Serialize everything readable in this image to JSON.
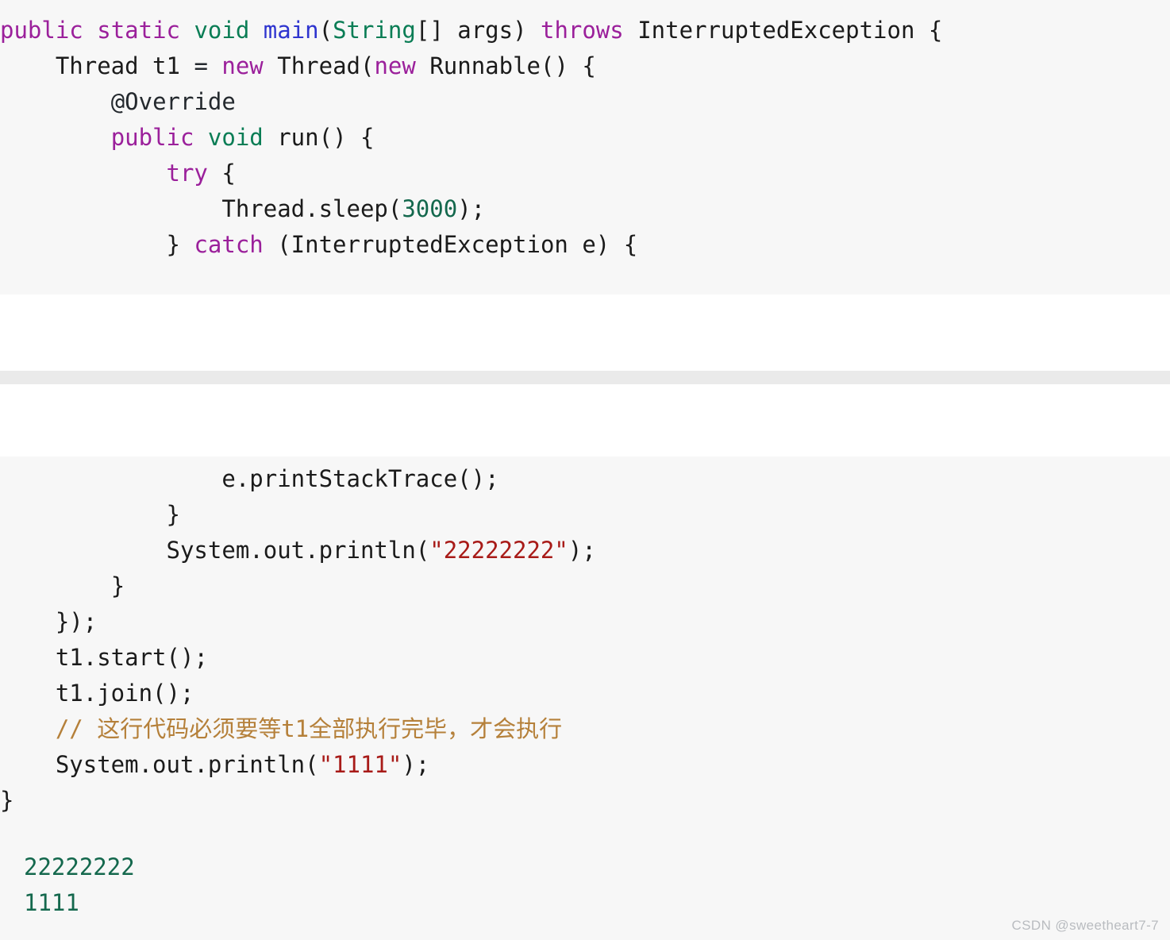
{
  "document": {
    "type": "code-snippet-article",
    "language": "Java",
    "background_color": "#f7f7f7",
    "page_background": "#ffffff",
    "separator_color": "#eaeaea"
  },
  "theme": {
    "plain": "#1b1b1b",
    "keyword": "#9b209b",
    "type": "#0a7d55",
    "method": "#2f35cf",
    "string": "#a81b18",
    "number": "#14684d",
    "comment": "#b5803a",
    "annotation": "#767676",
    "operator": "#8b1a1a",
    "output": "#14684d",
    "watermark": "#b9bcc0"
  },
  "code_block_top": {
    "lines": [
      {
        "indent": "",
        "tokens": [
          {
            "t": "public",
            "c": "keyword"
          },
          {
            "t": " ",
            "c": "plain"
          },
          {
            "t": "static",
            "c": "keyword"
          },
          {
            "t": " ",
            "c": "plain"
          },
          {
            "t": "void",
            "c": "type"
          },
          {
            "t": " ",
            "c": "plain"
          },
          {
            "t": "main",
            "c": "method"
          },
          {
            "t": "(",
            "c": "plain"
          },
          {
            "t": "String",
            "c": "type"
          },
          {
            "t": "[] args) ",
            "c": "plain"
          },
          {
            "t": "throws",
            "c": "keyword"
          },
          {
            "t": " InterruptedException {",
            "c": "plain"
          }
        ]
      },
      {
        "indent": "    ",
        "tokens": [
          {
            "t": "Thread t1 ",
            "c": "plain"
          },
          {
            "t": "=",
            "c": "operator"
          },
          {
            "t": " ",
            "c": "plain"
          },
          {
            "t": "new",
            "c": "keyword"
          },
          {
            "t": " Thread(",
            "c": "plain"
          },
          {
            "t": "new",
            "c": "keyword"
          },
          {
            "t": " Runnable() {",
            "c": "plain"
          }
        ]
      },
      {
        "indent": "        ",
        "tokens": [
          {
            "t": "@Override",
            "c": "annotation"
          }
        ]
      },
      {
        "indent": "        ",
        "tokens": [
          {
            "t": "public",
            "c": "keyword"
          },
          {
            "t": " ",
            "c": "plain"
          },
          {
            "t": "void",
            "c": "type"
          },
          {
            "t": " run() {",
            "c": "plain"
          }
        ]
      },
      {
        "indent": "            ",
        "tokens": [
          {
            "t": "try",
            "c": "keyword"
          },
          {
            "t": " {",
            "c": "plain"
          }
        ]
      },
      {
        "indent": "                ",
        "tokens": [
          {
            "t": "Thread.sleep(",
            "c": "plain"
          },
          {
            "t": "3000",
            "c": "number"
          },
          {
            "t": ");",
            "c": "plain"
          }
        ]
      },
      {
        "indent": "            ",
        "tokens": [
          {
            "t": "} ",
            "c": "plain"
          },
          {
            "t": "catch",
            "c": "keyword"
          },
          {
            "t": " (InterruptedException e) {",
            "c": "plain"
          }
        ]
      }
    ]
  },
  "code_block_bottom": {
    "lines": [
      {
        "indent": "                ",
        "tokens": [
          {
            "t": "e.printStackTrace();",
            "c": "plain"
          }
        ]
      },
      {
        "indent": "            ",
        "tokens": [
          {
            "t": "}",
            "c": "plain"
          }
        ]
      },
      {
        "indent": "            ",
        "tokens": [
          {
            "t": "System.out.println(",
            "c": "plain"
          },
          {
            "t": "\"22222222\"",
            "c": "string"
          },
          {
            "t": ");",
            "c": "plain"
          }
        ]
      },
      {
        "indent": "        ",
        "tokens": [
          {
            "t": "}",
            "c": "plain"
          }
        ]
      },
      {
        "indent": "    ",
        "tokens": [
          {
            "t": "});",
            "c": "plain"
          }
        ]
      },
      {
        "indent": "    ",
        "tokens": [
          {
            "t": "t1.start();",
            "c": "plain"
          }
        ]
      },
      {
        "indent": "    ",
        "tokens": [
          {
            "t": "t1.join();",
            "c": "plain"
          }
        ]
      },
      {
        "indent": "    ",
        "tokens": [
          {
            "t": "// 这行代码必须要等t1全部执行完毕，才会执行",
            "c": "comment"
          }
        ]
      },
      {
        "indent": "    ",
        "tokens": [
          {
            "t": "System.out.println(",
            "c": "plain"
          },
          {
            "t": "\"1111\"",
            "c": "string"
          },
          {
            "t": ");",
            "c": "plain"
          }
        ]
      },
      {
        "indent": "",
        "tokens": [
          {
            "t": "}",
            "c": "plain"
          }
        ]
      }
    ]
  },
  "console_output": {
    "lines": [
      "22222222",
      "1111"
    ]
  },
  "watermark": {
    "text": "CSDN @sweetheart7-7"
  }
}
